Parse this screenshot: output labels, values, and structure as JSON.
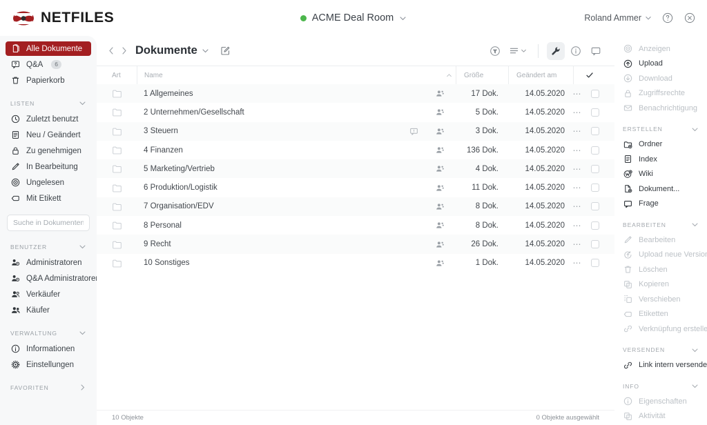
{
  "brand": {
    "name": "NETFILES"
  },
  "topbar": {
    "room_name": "ACME Deal Room",
    "room_status_color": "#4cb64c",
    "user_name": "Roland Ammer",
    "help_icon": "help-circle-icon",
    "close_icon": "close-circle-icon"
  },
  "sidebar": {
    "primary": [
      {
        "label": "Alle Dokumente",
        "icon": "documents-icon",
        "active": true
      },
      {
        "label": "Q&A",
        "icon": "question-bubble-icon",
        "badge": "6",
        "active": false
      },
      {
        "label": "Papierkorb",
        "icon": "trash-icon",
        "active": false
      }
    ],
    "sections": [
      {
        "title": "LISTEN",
        "expanded": true,
        "items": [
          {
            "label": "Zuletzt benutzt",
            "icon": "clock-icon"
          },
          {
            "label": "Neu / Geändert",
            "icon": "list-document-icon"
          },
          {
            "label": "Zu genehmigen",
            "icon": "lock-icon"
          },
          {
            "label": "In Bearbeitung",
            "icon": "pencil-icon"
          },
          {
            "label": "Ungelesen",
            "icon": "unread-circle-icon"
          },
          {
            "label": "Mit Etikett",
            "icon": "tag-icon"
          }
        ]
      },
      {
        "title": "BENUTZER",
        "expanded": true,
        "items": [
          {
            "label": "Administratoren",
            "icon": "users-gear-icon"
          },
          {
            "label": "Q&A Administratoren",
            "icon": "users-gear-icon"
          },
          {
            "label": "Verkäufer",
            "icon": "users-icon"
          },
          {
            "label": "Käufer",
            "icon": "users-filled-icon"
          }
        ]
      },
      {
        "title": "VERWALTUNG",
        "expanded": true,
        "items": [
          {
            "label": "Informationen",
            "icon": "info-circle-icon"
          },
          {
            "label": "Einstellungen",
            "icon": "gear-icon"
          }
        ]
      },
      {
        "title": "FAVORITEN",
        "expanded": false,
        "items": []
      }
    ],
    "search": {
      "placeholder": "Suche in Dokumenten...",
      "value": ""
    }
  },
  "main": {
    "breadcrumb_title": "Dokumente",
    "nav_back_icon": "chevron-left-icon",
    "nav_forward_icon": "chevron-right-icon",
    "edit_icon": "edit-square-icon",
    "toolbar_right": [
      {
        "name": "filter-icon",
        "active": false
      },
      {
        "name": "view-list-icon",
        "active": false,
        "has_caret": true
      },
      {
        "name": "wrench-icon",
        "active": true
      },
      {
        "name": "info-circle-icon",
        "active": false
      },
      {
        "name": "comment-bubble-icon",
        "active": false
      }
    ],
    "table": {
      "columns": [
        "Art",
        "Name",
        "Größe",
        "Geändert am"
      ],
      "sort_column": "Name",
      "sort_direction": "asc",
      "select_all_icon": "check-icon",
      "rows": [
        {
          "name": "1 Allgemeines",
          "size": "17 Dok.",
          "modified": "14.05.2020",
          "has_note": false,
          "icon": "folder-icon",
          "perm_icon": "permissions-users-icon",
          "selected": false
        },
        {
          "name": "2 Unternehmen/Gesellschaft",
          "size": "5 Dok.",
          "modified": "14.05.2020",
          "has_note": false,
          "icon": "folder-icon",
          "perm_icon": "permissions-users-icon",
          "selected": false
        },
        {
          "name": "3 Steuern",
          "size": "3 Dok.",
          "modified": "14.05.2020",
          "has_note": true,
          "icon": "folder-icon",
          "perm_icon": "permissions-users-icon",
          "selected": false
        },
        {
          "name": "4 Finanzen",
          "size": "136 Dok.",
          "modified": "14.05.2020",
          "has_note": false,
          "icon": "folder-icon",
          "perm_icon": "permissions-users-icon",
          "selected": false
        },
        {
          "name": "5 Marketing/Vertrieb",
          "size": "4 Dok.",
          "modified": "14.05.2020",
          "has_note": false,
          "icon": "folder-icon",
          "perm_icon": "permissions-users-icon",
          "selected": false
        },
        {
          "name": "6 Produktion/Logistik",
          "size": "11 Dok.",
          "modified": "14.05.2020",
          "has_note": false,
          "icon": "folder-icon",
          "perm_icon": "permissions-users-icon",
          "selected": false
        },
        {
          "name": "7 Organisation/EDV",
          "size": "8 Dok.",
          "modified": "14.05.2020",
          "has_note": false,
          "icon": "folder-icon",
          "perm_icon": "permissions-users-icon",
          "selected": false
        },
        {
          "name": "8 Personal",
          "size": "8 Dok.",
          "modified": "14.05.2020",
          "has_note": false,
          "icon": "folder-icon",
          "perm_icon": "permissions-users-icon",
          "selected": false
        },
        {
          "name": "9 Recht",
          "size": "26 Dok.",
          "modified": "14.05.2020",
          "has_note": false,
          "icon": "folder-icon",
          "perm_icon": "permissions-users-icon",
          "selected": false
        },
        {
          "name": "10 Sonstiges",
          "size": "1 Dok.",
          "modified": "14.05.2020",
          "has_note": false,
          "icon": "folder-icon",
          "perm_icon": "permissions-users-icon",
          "selected": false
        }
      ]
    },
    "status": {
      "left": "10 Objekte",
      "right": "0 Objekte ausgewählt"
    }
  },
  "right_panel": {
    "top_actions": [
      {
        "label": "Anzeigen",
        "icon": "eye-target-icon",
        "disabled": true
      },
      {
        "label": "Upload",
        "icon": "upload-icon",
        "disabled": false
      },
      {
        "label": "Download",
        "icon": "download-icon",
        "disabled": true
      },
      {
        "label": "Zugriffsrechte",
        "icon": "lock-icon",
        "disabled": true
      },
      {
        "label": "Benachrichtigung",
        "icon": "envelope-icon",
        "disabled": true
      }
    ],
    "sections": [
      {
        "title": "ERSTELLEN",
        "expanded": true,
        "items": [
          {
            "label": "Ordner",
            "icon": "folder-add-icon",
            "disabled": false
          },
          {
            "label": "Index",
            "icon": "index-icon",
            "disabled": false
          },
          {
            "label": "Wiki",
            "icon": "wiki-icon",
            "disabled": false
          },
          {
            "label": "Dokument...",
            "icon": "document-add-icon",
            "disabled": false
          },
          {
            "label": "Frage",
            "icon": "comment-bubble-icon",
            "disabled": false
          }
        ]
      },
      {
        "title": "BEARBEITEN",
        "expanded": true,
        "items": [
          {
            "label": "Bearbeiten",
            "icon": "pencil-icon",
            "disabled": true
          },
          {
            "label": "Upload neue Version",
            "icon": "upload-version-icon",
            "disabled": true
          },
          {
            "label": "Löschen",
            "icon": "trash-icon",
            "disabled": true
          },
          {
            "label": "Kopieren",
            "icon": "copy-icon",
            "disabled": true
          },
          {
            "label": "Verschieben",
            "icon": "move-icon",
            "disabled": true
          },
          {
            "label": "Etiketten",
            "icon": "tag-icon",
            "disabled": true
          },
          {
            "label": "Verknüpfung erstellen",
            "icon": "link-icon",
            "disabled": true
          }
        ]
      },
      {
        "title": "VERSENDEN",
        "expanded": true,
        "items": [
          {
            "label": "Link intern versenden",
            "icon": "link-icon",
            "disabled": false
          }
        ]
      },
      {
        "title": "INFO",
        "expanded": true,
        "items": [
          {
            "label": "Eigenschaften",
            "icon": "info-circle-icon",
            "disabled": true
          },
          {
            "label": "Aktivität",
            "icon": "copy-icon",
            "disabled": true
          }
        ]
      }
    ]
  },
  "colors": {
    "brand_red": "#a31f21",
    "accent_green": "#4cb64c",
    "sidebar_bg": "#f7f8f9"
  }
}
